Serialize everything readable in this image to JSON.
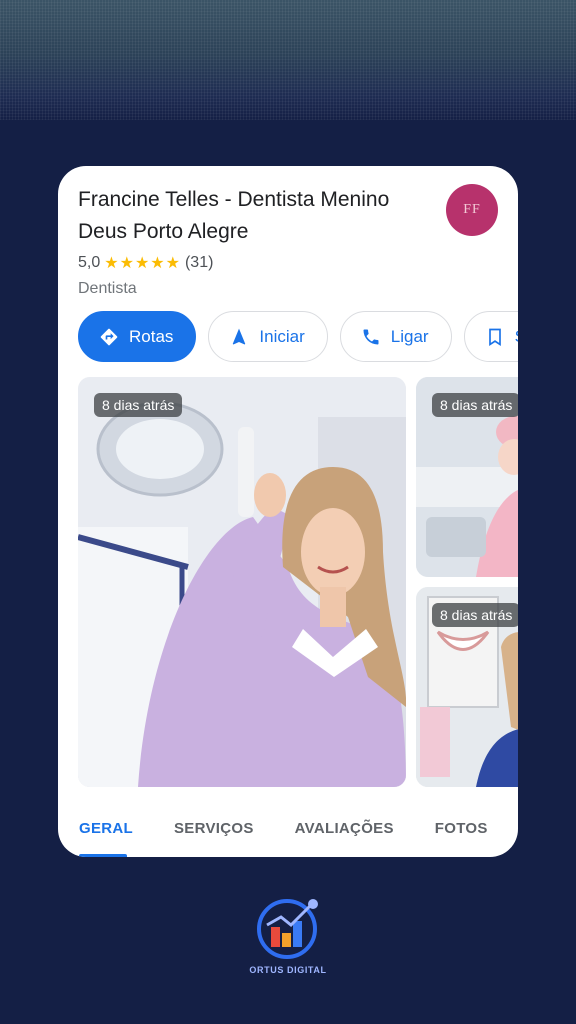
{
  "place": {
    "name": "Francine Telles - Dentista Menino Deus Porto Alegre",
    "logo_text": "FF",
    "rating": "5,0",
    "stars": "★★★★★",
    "review_count": "(31)",
    "category": "Dentista"
  },
  "actions": [
    {
      "label": "Rotas",
      "icon": "directions-icon"
    },
    {
      "label": "Iniciar",
      "icon": "navigation-arrow-icon"
    },
    {
      "label": "Ligar",
      "icon": "phone-icon"
    },
    {
      "label": "S",
      "icon": "bookmark-icon"
    }
  ],
  "photos": [
    {
      "badge": "8 dias atrás"
    },
    {
      "badge": "8 dias atrás"
    },
    {
      "badge": "8 dias atrás"
    }
  ],
  "tabs": [
    {
      "label": "GERAL",
      "active": true
    },
    {
      "label": "SERVIÇOS",
      "active": false
    },
    {
      "label": "AVALIAÇÕES",
      "active": false
    },
    {
      "label": "FOTOS",
      "active": false
    }
  ],
  "brand": {
    "name": "ORTUS DIGITAL"
  },
  "colors": {
    "background": "#141f45",
    "accent": "#1a73e8",
    "star": "#fbbc04",
    "logo": "#b7326c"
  }
}
